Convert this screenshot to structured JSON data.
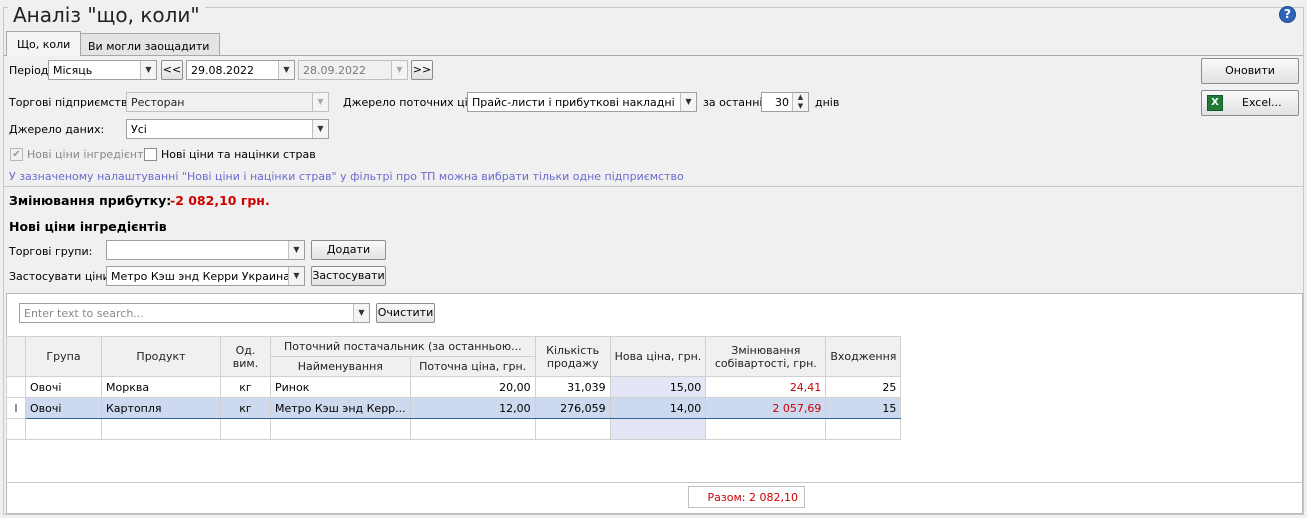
{
  "window": {
    "title": "Аналіз \"що, коли\"",
    "help_label": "?"
  },
  "tabs": [
    {
      "label": "Що, коли"
    },
    {
      "label": "Ви могли заощадити"
    }
  ],
  "filters": {
    "period_label": "Період",
    "period_value": "Місяць",
    "prev_label": "<<",
    "date_from": "29.08.2022",
    "date_to": "28.09.2022",
    "next_label": ">>",
    "enterprises_label": "Торгові підприємства:",
    "enterprises_value": "Ресторан",
    "price_source_label": "Джерело поточних цін:",
    "price_source_value": "Прайс-листи і прибуткові накладні",
    "for_last_label": "за останні",
    "days_value": "30",
    "days_label": "днів",
    "data_source_label": "Джерело даних:",
    "data_source_value": "Усі",
    "new_ingredient_prices_label": "Нові ціни інгредієнтів",
    "new_ingredient_prices_checked": true,
    "new_dish_prices_label": "Нові ціни та націнки страв",
    "new_dish_prices_checked": false,
    "hint": "У зазначеному налаштуванні \"Нові ціни і націнки страв\" у фільтрі про ТП можна вибрати тільки одне підприємство"
  },
  "actions": {
    "refresh_label": "Оновити",
    "excel_label": "Excel..."
  },
  "profit": {
    "label": "Змінювання прибутку:",
    "value": "-2 082,10 грн."
  },
  "ingredients_section": {
    "title": "Нові ціни інгредієнтів",
    "trade_groups_label": "Торгові групи:",
    "trade_groups_value": "",
    "add_label": "Додати",
    "apply_prices_label": "Застосувати ціни:",
    "apply_prices_value": "Метро Кэш энд Керри Украина ТОВ",
    "apply_label": "Застосувати"
  },
  "search": {
    "placeholder": "Enter text to search...",
    "clear_label": "Очистити"
  },
  "table": {
    "headers": {
      "group": "Група",
      "product": "Продукт",
      "unit": "Од. вим.",
      "supplier_group": "Поточний постачальник (за останньою...",
      "supplier_name": "Найменування",
      "current_price": "Поточна ціна, грн.",
      "sales_qty": "Кількість продажу",
      "new_price": "Нова ціна, грн.",
      "cost_change": "Змінювання собівартості, грн.",
      "occurrences": "Входження"
    },
    "rows": [
      {
        "group": "Овочі",
        "product": "Морква",
        "unit": "кг",
        "supplier": "Ринок",
        "current_price": "20,00",
        "qty": "31,039",
        "new_price": "15,00",
        "cost_change": "24,41",
        "occurrences": "25"
      },
      {
        "group": "Овочі",
        "product": "Картопля",
        "unit": "кг",
        "supplier": "Метро Кэш энд Керр...",
        "current_price": "12,00",
        "qty": "276,059",
        "new_price": "14,00",
        "cost_change": "2 057,69",
        "occurrences": "15"
      }
    ],
    "total": "Разом: 2 082,10"
  }
}
